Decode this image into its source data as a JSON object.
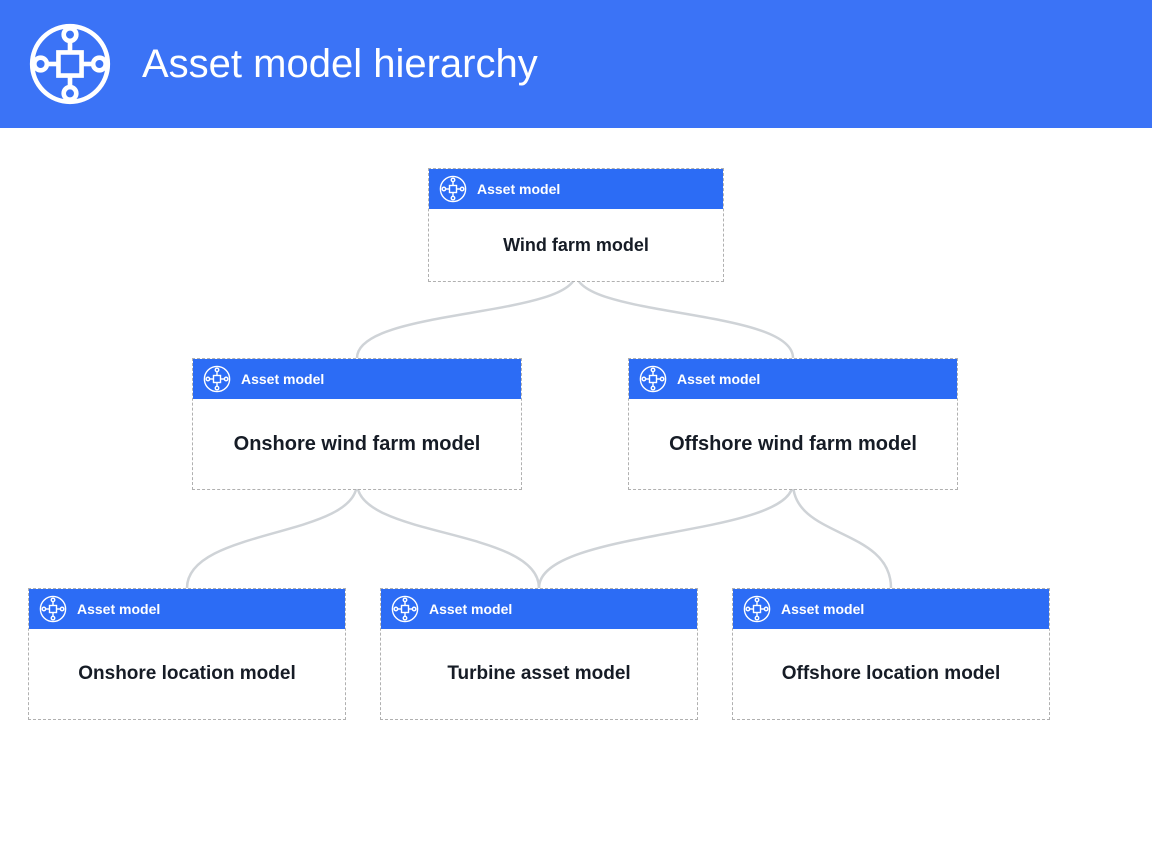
{
  "header": {
    "title": "Asset model hierarchy"
  },
  "card_label": "Asset model",
  "nodes": {
    "root": "Wind farm model",
    "onshore": "Onshore wind farm model",
    "offshore": "Offshore wind farm model",
    "onloc": "Onshore location model",
    "turbine": "Turbine asset model",
    "offloc": "Offshore location model"
  },
  "colors": {
    "header_bg": "#3B73F6",
    "card_header_bg": "#2C6CF5",
    "connector": "#cfd3d7"
  }
}
